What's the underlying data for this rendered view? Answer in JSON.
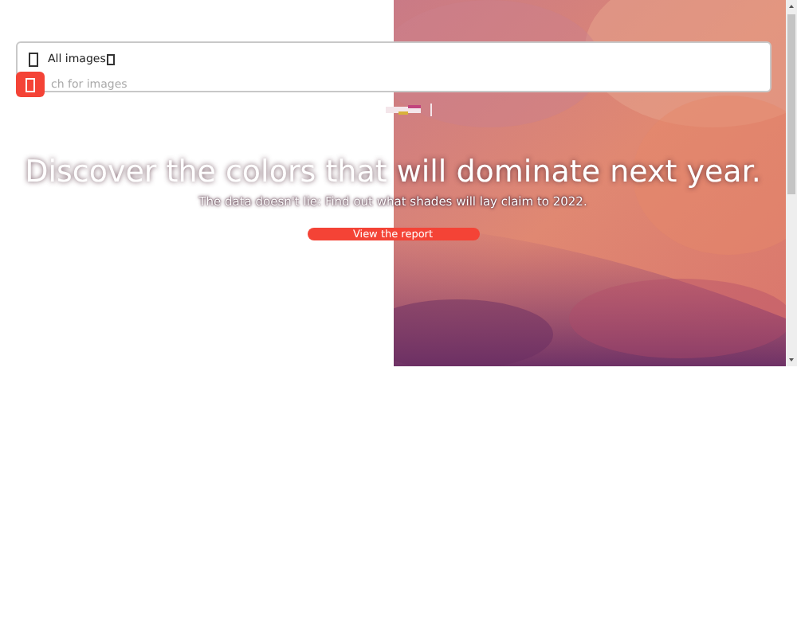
{
  "search": {
    "scope": "All images",
    "placeholder": "ch for images"
  },
  "hero": {
    "headline": "Discover the colors that will dominate next year.",
    "subtitle": "The data doesn't lie: Find out what shades will lay claim to 2022.",
    "button": "View the report"
  }
}
